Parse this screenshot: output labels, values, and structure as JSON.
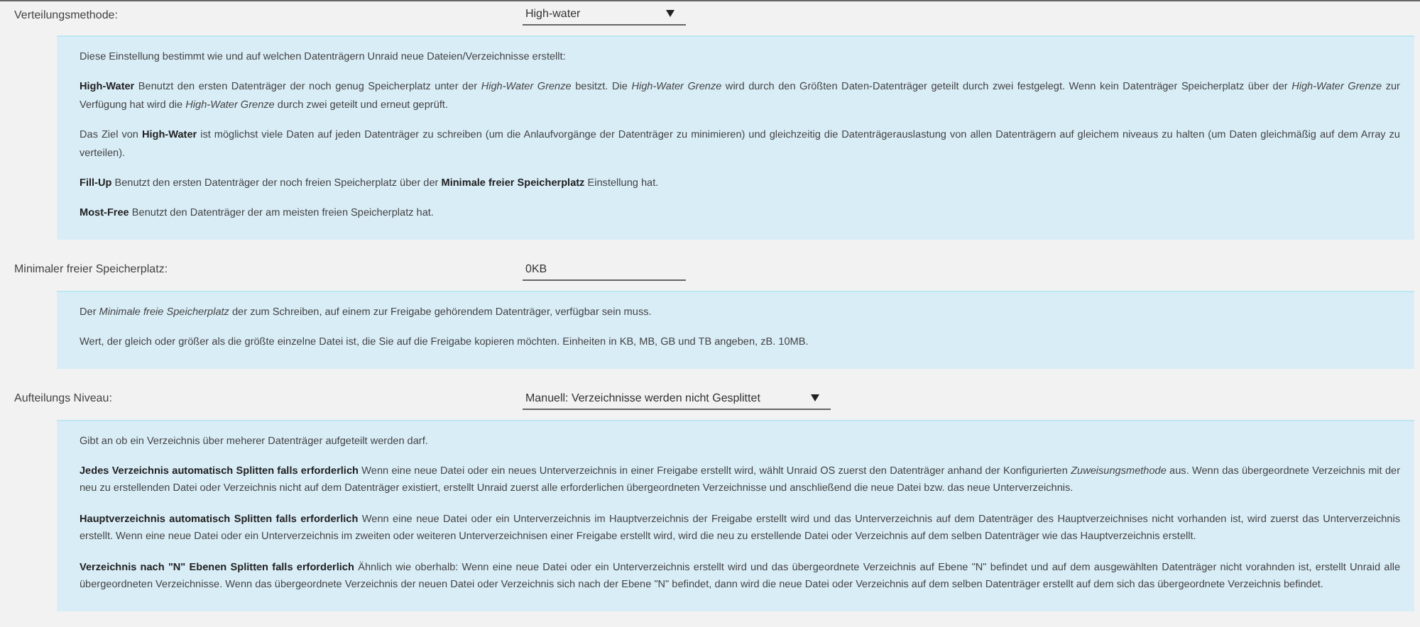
{
  "settings": [
    {
      "label": "Verteilungsmethode:",
      "kind": "select",
      "value": "High-water",
      "help": [
        "Diese Einstellung bestimmt wie und auf welchen Datenträgern Unraid neue Dateien/Verzeichnisse erstellt:",
        "**High-Water** Benutzt den ersten Datenträger der noch genug Speicherplatz unter der *High-Water Grenze* besitzt. Die *High-Water Grenze* wird durch den Größten Daten-Datenträger geteilt durch zwei festgelegt. Wenn kein Datenträger Speicherplatz über der *High-Water Grenze* zur Verfügung hat wird die *High-Water Grenze* durch zwei geteilt und erneut geprüft.",
        "Das Ziel von **High-Water** ist möglichst viele Daten auf jeden Datenträger zu schreiben (um die Anlaufvorgänge der Datenträger zu minimieren) und gleichzeitig die Datenträgerauslastung von allen Datenträgern auf gleichem niveaus zu halten (um Daten gleichmäßig auf dem Array zu verteilen).",
        "**Fill-Up** Benutzt den ersten Datenträger der noch freien Speicherplatz über der **Minimale freier Speicherplatz** Einstellung hat.",
        "**Most-Free** Benutzt den Datenträger der am meisten freien Speicherplatz hat."
      ]
    },
    {
      "label": "Minimaler freier Speicherplatz:",
      "kind": "input",
      "value": "0KB",
      "help": [
        "Der *Minimale freie Speicherplatz* der zum Schreiben, auf einem zur Freigabe gehörendem Datenträger, verfügbar sein muss.",
        "Wert, der gleich oder größer als die größte einzelne Datei ist, die Sie auf die Freigabe kopieren möchten. Einheiten in KB, MB, GB und TB angeben, zB. 10MB."
      ]
    },
    {
      "label": "Aufteilungs Niveau:",
      "kind": "select",
      "value": "Manuell: Verzeichnisse werden nicht Gesplittet",
      "help": [
        "Gibt an ob ein Verzeichnis über meherer Datenträger aufgeteilt werden darf.",
        "**Jedes Verzeichnis automatisch Splitten falls erforderlich** Wenn eine neue Datei oder ein neues Unterverzeichnis in einer Freigabe erstellt wird, wählt Unraid OS zuerst den Datenträger anhand der Konfigurierten *Zuweisungsmethode* aus. Wenn das übergeordnete Verzeichnis mit der neu zu erstellenden Datei oder Verzeichnis nicht auf dem Datenträger existiert, erstellt Unraid zuerst alle erforderlichen übergeordneten Verzeichnisse und anschließend die neue Datei bzw. das neue Unterverzeichnis.",
        "**Hauptverzeichnis automatisch Splitten falls erforderlich** Wenn eine neue Datei oder ein Unterverzeichnis im Hauptverzeichnis der Freigabe erstellt wird und das Unterverzeichnis auf dem Datenträger des Hauptverzeichnises nicht vorhanden ist, wird zuerst das Unterverzeichnis erstellt. Wenn eine neue Datei oder ein Unterverzeichnis im zweiten oder weiteren Unterverzeichnisen einer Freigabe erstellt wird, wird die neu zu erstellende Datei oder Verzeichnis auf dem selben Datenträger wie das Hauptverzeichnis erstellt.",
        "**Verzeichnis nach \"N\" Ebenen Splitten falls erforderlich** Ähnlich wie oberhalb: Wenn eine neue Datei oder ein Unterverzeichnis erstellt wird und das übergeordnete Verzeichnis auf Ebene \"N\" befindet und auf dem ausgewählten Datenträger nicht vorahnden ist, erstellt Unraid alle übergeordneten Verzeichnisse. Wenn das übergeordnete Verzeichnis der neuen Datei oder Verzeichnis sich nach der Ebene \"N\" befindet, dann wird die neue Datei oder Verzeichnis auf dem selben Datenträger erstellt auf dem sich das übergeordnete Verzeichnis befindet."
      ]
    }
  ]
}
